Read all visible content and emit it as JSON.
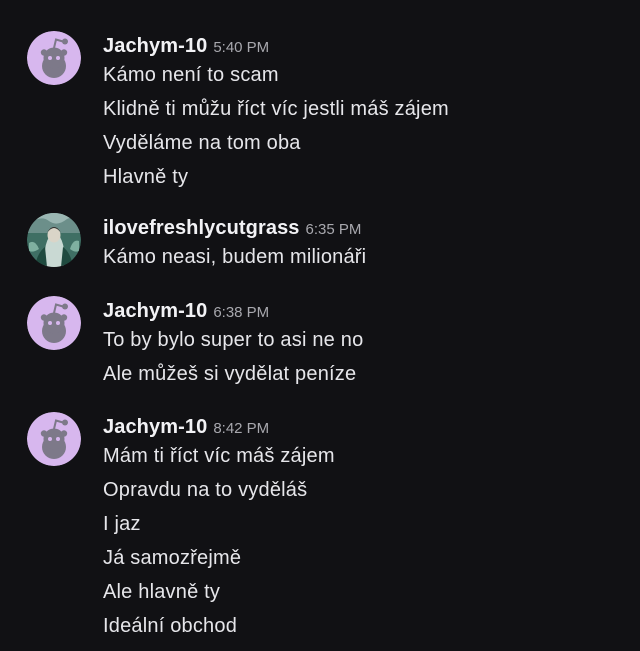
{
  "groups": [
    {
      "username": "Jachym-10",
      "time": "5:40 PM",
      "avatar": "reddit-snoo-icon",
      "messages": [
        "Kámo není to scam",
        "Klidně ti můžu říct víc jestli máš zájem",
        "Vyděláme na tom oba",
        "Hlavně ty"
      ]
    },
    {
      "username": "ilovefreshlycutgrass",
      "time": "6:35 PM",
      "avatar": "user-photo-avatar",
      "messages": [
        "Kámo neasi, budem milionáři"
      ]
    },
    {
      "username": "Jachym-10",
      "time": "6:38 PM",
      "avatar": "reddit-snoo-icon",
      "messages": [
        "To by bylo super to asi ne no",
        "Ale můžeš si vydělat peníze"
      ]
    },
    {
      "username": "Jachym-10",
      "time": "8:42 PM",
      "avatar": "reddit-snoo-icon",
      "messages": [
        "Mám ti říct víc máš zájem",
        "Opravdu na to vyděláš",
        "I jaz",
        "Já samozřejmě",
        "Ale hlavně ty",
        "Ideální obchod"
      ]
    }
  ],
  "colors": {
    "background": "#111114",
    "avatar_default": "#d7b7ee"
  }
}
